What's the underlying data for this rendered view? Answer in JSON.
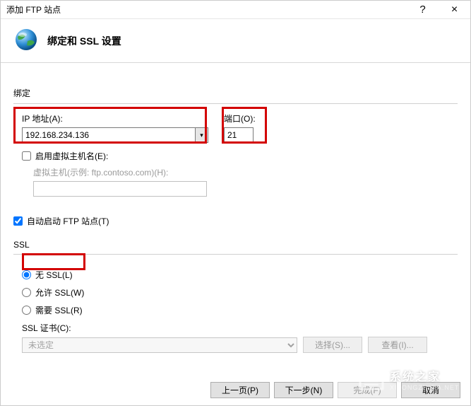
{
  "window": {
    "title": "添加 FTP 站点",
    "help": "?",
    "close": "×"
  },
  "header": {
    "title": "绑定和 SSL 设置"
  },
  "binding": {
    "group_label": "绑定",
    "ip_label": "IP 地址(A):",
    "ip_value": "192.168.234.136",
    "port_label": "端口(O):",
    "port_value": "21",
    "vhost_checkbox_label": "启用虚拟主机名(E):",
    "vhost_checked": false,
    "vhost_label": "虚拟主机(示例: ftp.contoso.com)(H):",
    "vhost_value": ""
  },
  "autostart": {
    "label": "自动启动 FTP 站点(T)",
    "checked": true
  },
  "ssl": {
    "group_label": "SSL",
    "options": {
      "none": "无 SSL(L)",
      "allow": "允许 SSL(W)",
      "require": "需要 SSL(R)"
    },
    "selected": "none",
    "cert_label": "SSL 证书(C):",
    "cert_value": "未选定",
    "select_btn": "选择(S)...",
    "view_btn": "查看(I)..."
  },
  "footer": {
    "prev": "上一页(P)",
    "next": "下一步(N)",
    "finish": "完成(F)",
    "cancel": "取消"
  },
  "watermark": {
    "text": "系统之家",
    "sub": "XITONGZHIJIA.NET"
  }
}
